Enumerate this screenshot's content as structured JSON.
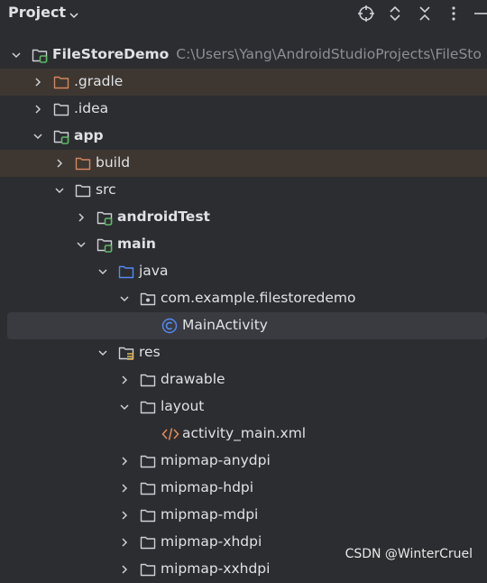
{
  "header": {
    "title": "Project",
    "icons": [
      "target-icon",
      "expand-all-icon",
      "collapse-all-icon",
      "more-vertical-icon",
      "minimize-icon"
    ]
  },
  "tree": [
    {
      "label": "FileStoreDemo",
      "path": "C:\\Users\\Yang\\AndroidStudioProjects\\FileSto",
      "indent": 0,
      "expanded": true,
      "icon": "module",
      "bold": true
    },
    {
      "label": ".gradle",
      "indent": 1,
      "expanded": false,
      "icon": "folder-excluded",
      "excluded": true
    },
    {
      "label": ".idea",
      "indent": 1,
      "expanded": false,
      "icon": "folder"
    },
    {
      "label": "app",
      "indent": 1,
      "expanded": true,
      "icon": "module",
      "bold": true
    },
    {
      "label": "build",
      "indent": 2,
      "expanded": false,
      "icon": "folder-excluded",
      "excluded": true
    },
    {
      "label": "src",
      "indent": 2,
      "expanded": true,
      "icon": "folder"
    },
    {
      "label": "androidTest",
      "indent": 3,
      "expanded": false,
      "icon": "module",
      "bold": true
    },
    {
      "label": "main",
      "indent": 3,
      "expanded": true,
      "icon": "module",
      "bold": true
    },
    {
      "label": "java",
      "indent": 4,
      "expanded": true,
      "icon": "folder-source"
    },
    {
      "label": "com.example.filestoredemo",
      "indent": 5,
      "expanded": true,
      "icon": "package"
    },
    {
      "label": "MainActivity",
      "indent": 6,
      "leaf": true,
      "icon": "class",
      "selected": true
    },
    {
      "label": "res",
      "indent": 4,
      "expanded": true,
      "icon": "folder-resources"
    },
    {
      "label": "drawable",
      "indent": 5,
      "expanded": false,
      "icon": "folder"
    },
    {
      "label": "layout",
      "indent": 5,
      "expanded": true,
      "icon": "folder"
    },
    {
      "label": "activity_main.xml",
      "indent": 6,
      "leaf": true,
      "icon": "xml"
    },
    {
      "label": "mipmap-anydpi",
      "indent": 5,
      "expanded": false,
      "icon": "folder"
    },
    {
      "label": "mipmap-hdpi",
      "indent": 5,
      "expanded": false,
      "icon": "folder"
    },
    {
      "label": "mipmap-mdpi",
      "indent": 5,
      "expanded": false,
      "icon": "folder"
    },
    {
      "label": "mipmap-xhdpi",
      "indent": 5,
      "expanded": false,
      "icon": "folder"
    },
    {
      "label": "mipmap-xxhdpi",
      "indent": 5,
      "expanded": false,
      "icon": "folder"
    }
  ],
  "watermark": "CSDN @WinterCruel",
  "colors": {
    "background": "#2b2d30",
    "excluded_row": "#3e3731",
    "selected_row": "#393b40",
    "text": "#dfe1e5",
    "path_text": "#8c8f94",
    "folder_stroke": "#ced0d6",
    "excluded_folder": "#d3865c",
    "module_badge": "#5fb865",
    "source_folder": "#548af7",
    "class_icon": "#548af7",
    "xml_icon": "#e08855"
  }
}
